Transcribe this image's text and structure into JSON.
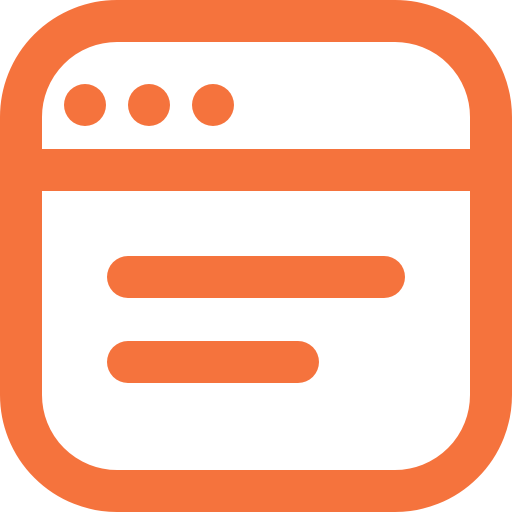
{
  "icon": {
    "name": "browser-window-icon",
    "color": "#F5733D",
    "background": "#FFFFFF"
  }
}
